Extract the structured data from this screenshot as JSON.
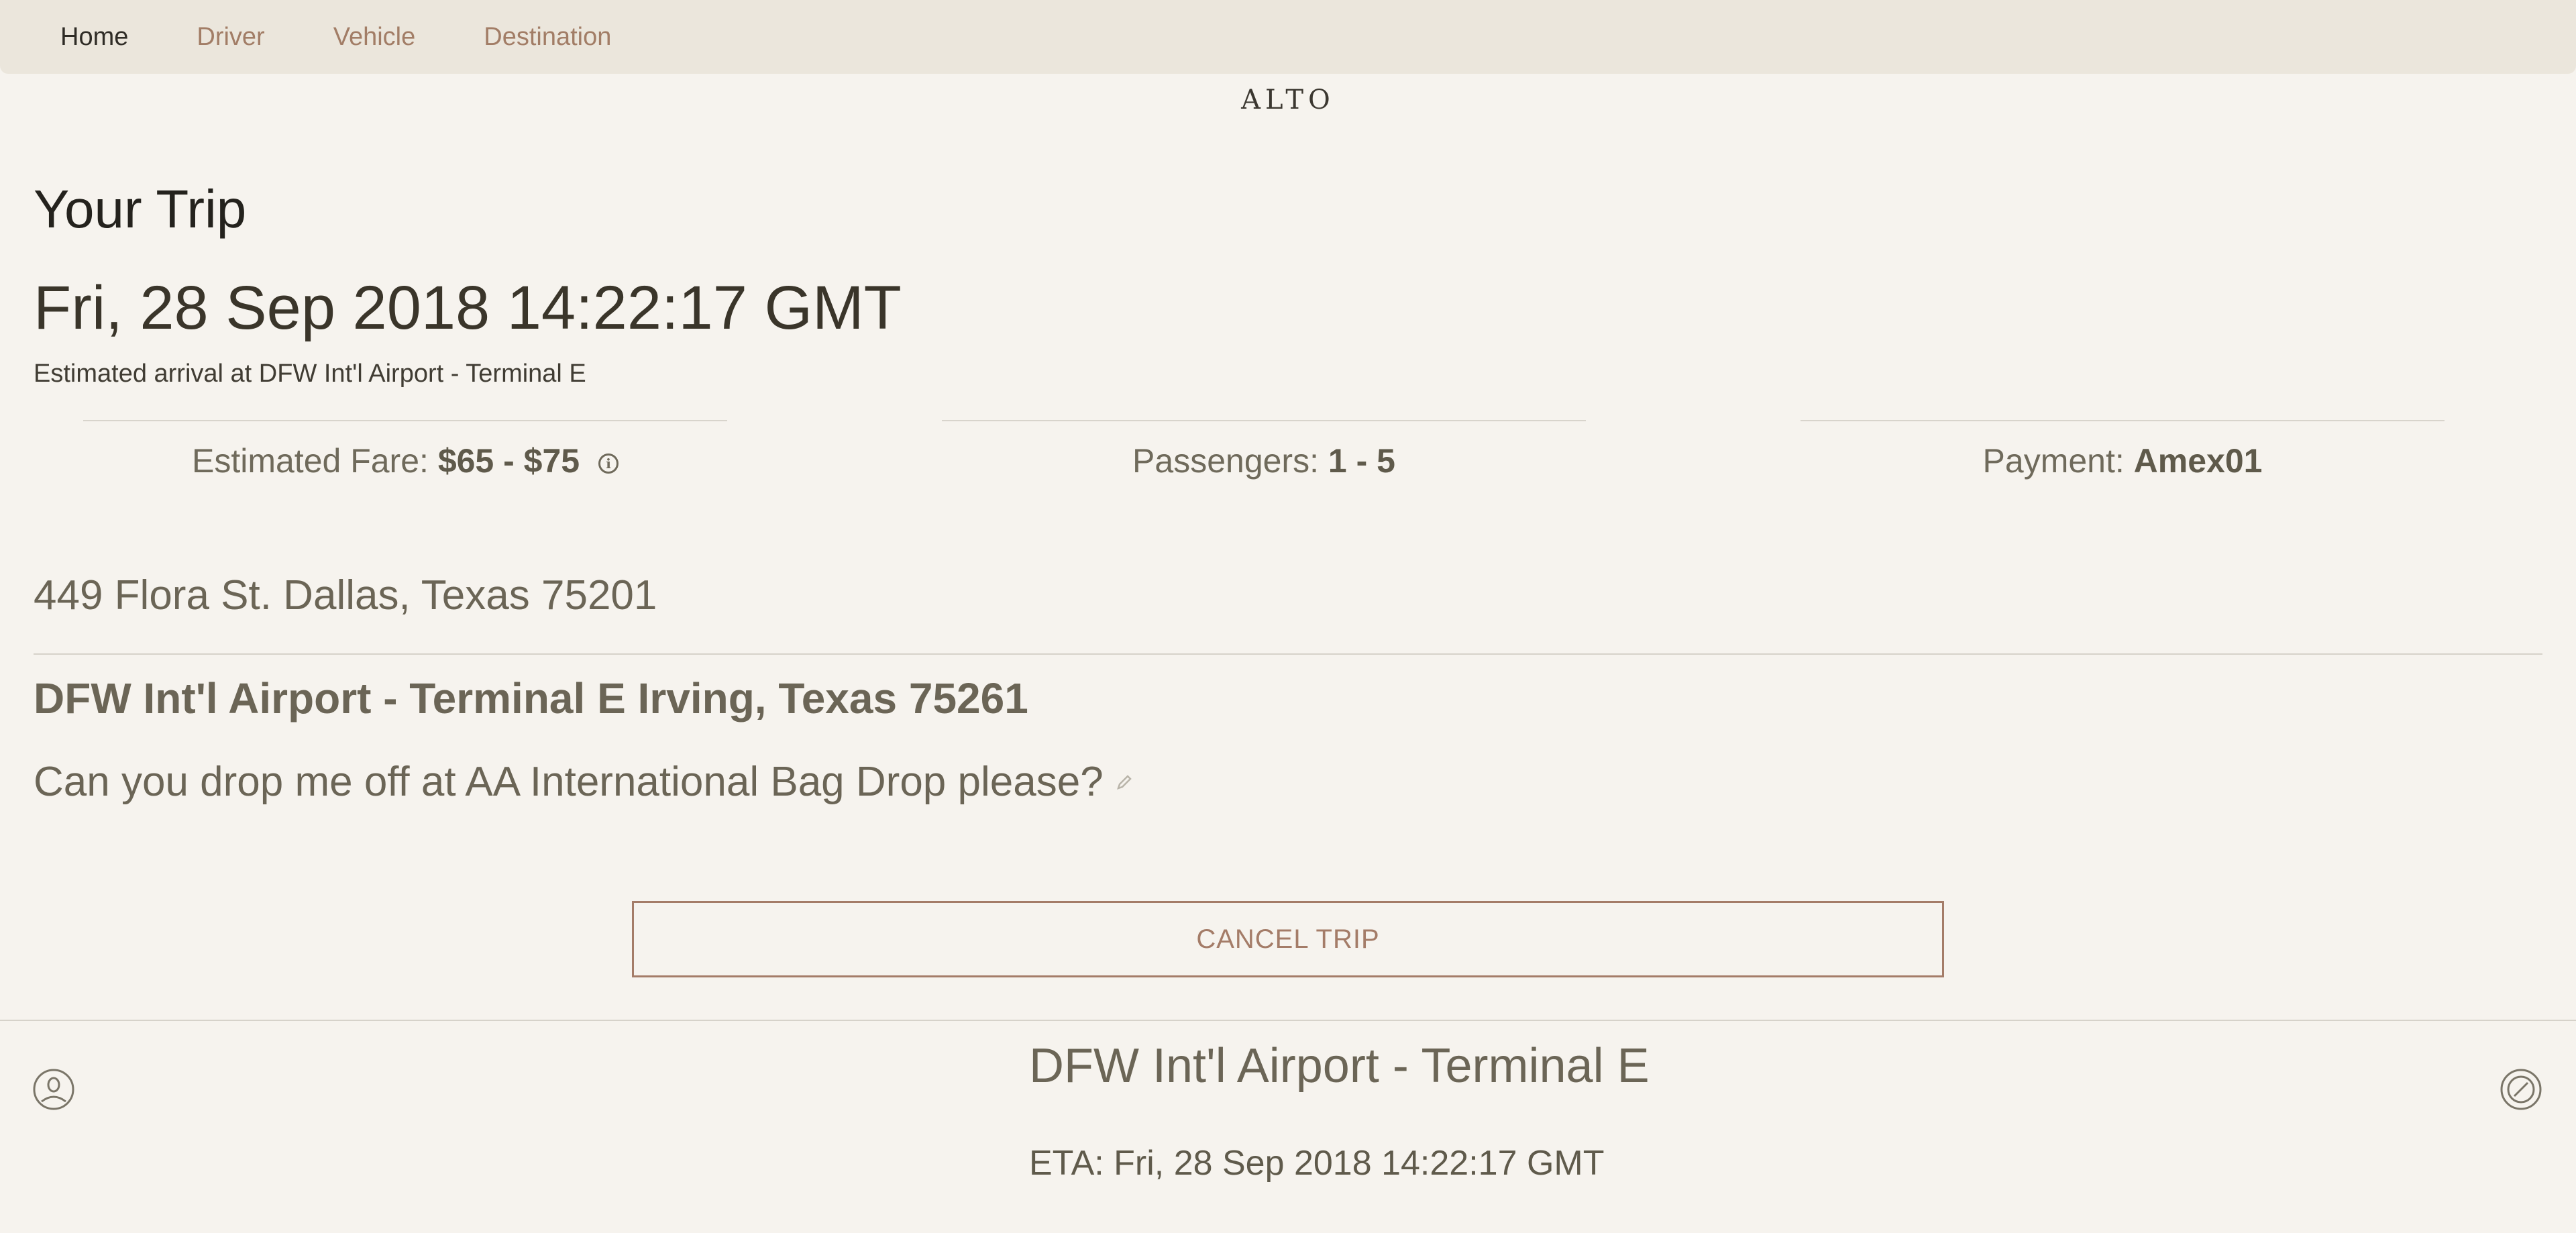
{
  "nav": {
    "items": [
      {
        "label": "Home",
        "active": true
      },
      {
        "label": "Driver",
        "active": false
      },
      {
        "label": "Vehicle",
        "active": false
      },
      {
        "label": "Destination",
        "active": false
      }
    ]
  },
  "brand": {
    "logo_text": "ALTO"
  },
  "trip": {
    "heading": "Your Trip",
    "datetime": "Fri, 28 Sep 2018 14:22:17 GMT",
    "subtitle": "Estimated arrival at DFW Int'l Airport - Terminal E"
  },
  "stats": {
    "fare_label": "Estimated Fare:",
    "fare_value": "$65 - $75",
    "passengers_label": "Passengers:",
    "passengers_value": "1 - 5",
    "payment_label": "Payment:",
    "payment_value": "Amex01"
  },
  "route": {
    "pickup": "449 Flora St. Dallas, Texas 75201",
    "dropoff": "DFW Int'l Airport - Terminal E Irving, Texas 75261",
    "note": "Can you drop me off at AA International Bag Drop please?"
  },
  "actions": {
    "cancel_label": "CANCEL TRIP"
  },
  "footer": {
    "destination": "DFW Int'l Airport - Terminal E",
    "eta": "ETA: Fri, 28 Sep 2018 14:22:17 GMT"
  },
  "icons": {
    "fare_info": "info-icon",
    "note_edit": "pencil-icon",
    "profile": "user-icon",
    "location": "target-icon"
  },
  "colors": {
    "background": "#f6f3ee",
    "nav_background": "#ebe6dc",
    "accent": "#a47c68",
    "text_dark": "#24221d",
    "text_muted": "#6b6556"
  }
}
